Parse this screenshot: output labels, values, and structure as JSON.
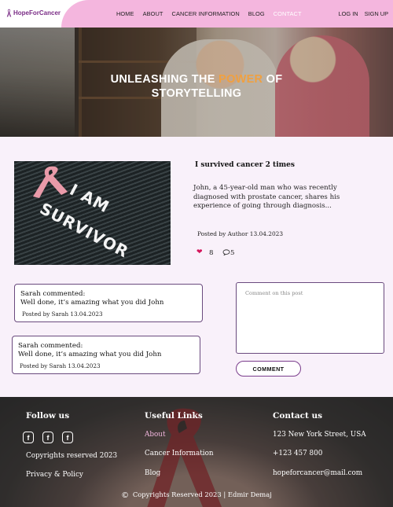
{
  "nav": {
    "logo": "HopeForCancer",
    "links": [
      {
        "label": "HOME",
        "active": false
      },
      {
        "label": "ABOUT",
        "active": false
      },
      {
        "label": "CANCER INFORMATION",
        "active": false
      },
      {
        "label": "BLOG",
        "active": false
      },
      {
        "label": "CONTACT",
        "active": true
      }
    ],
    "login": "LOG IN",
    "signup": "SIGN UP",
    "colors": {
      "bar": "#f4b6de",
      "brand": "#7a2d86"
    }
  },
  "hero": {
    "title_part1": "UNLEASHING THE ",
    "title_accent": "POWER",
    "title_part2": " OF",
    "title_line2": "STORYTELLING",
    "accent_color": "#f0a040"
  },
  "post": {
    "image_text_line1": "I AM",
    "image_text_line2": "SURVIVOR",
    "title": "I survived cancer 2 times",
    "excerpt": "John, a 45-year-old man who was recently diagnosed with prostate cancer, shares his experience of going through diagnosis...",
    "meta": "Posted by Author 13.04.2023",
    "likes": "8",
    "comments": "5",
    "like_icon": "heart-icon",
    "comment_icon": "speech-bubble-icon"
  },
  "comments": [
    {
      "author_line": "Sarah commented:",
      "text": "Well done, it’s amazing what you did John",
      "posted": "Posted by Sarah 13.04.2023"
    },
    {
      "author_line": "Sarah commented:",
      "text": "Well done, it’s amazing what you did John",
      "posted": "Posted by Sarah 13.04.2023"
    }
  ],
  "comment_form": {
    "placeholder": "Comment on this post",
    "button": "COMMENT"
  },
  "footer": {
    "follow_title": "Follow us",
    "social_icons": [
      "facebook-icon",
      "facebook-icon",
      "facebook-icon"
    ],
    "copyright_short": "Copyrights reserved 2023",
    "privacy": "Privacy & Policy",
    "links_title": "Useful Links",
    "links": [
      "About",
      "Cancer Information",
      "Blog"
    ],
    "contact_title": "Contact us",
    "address": "123 New York Street, USA",
    "phone": "+123 457 800",
    "email": "hopeforcancer@mail.com",
    "bottom": "Copyrights Reserved 2023 | Edmir Demaj",
    "link_accent": "#f2b6de"
  }
}
